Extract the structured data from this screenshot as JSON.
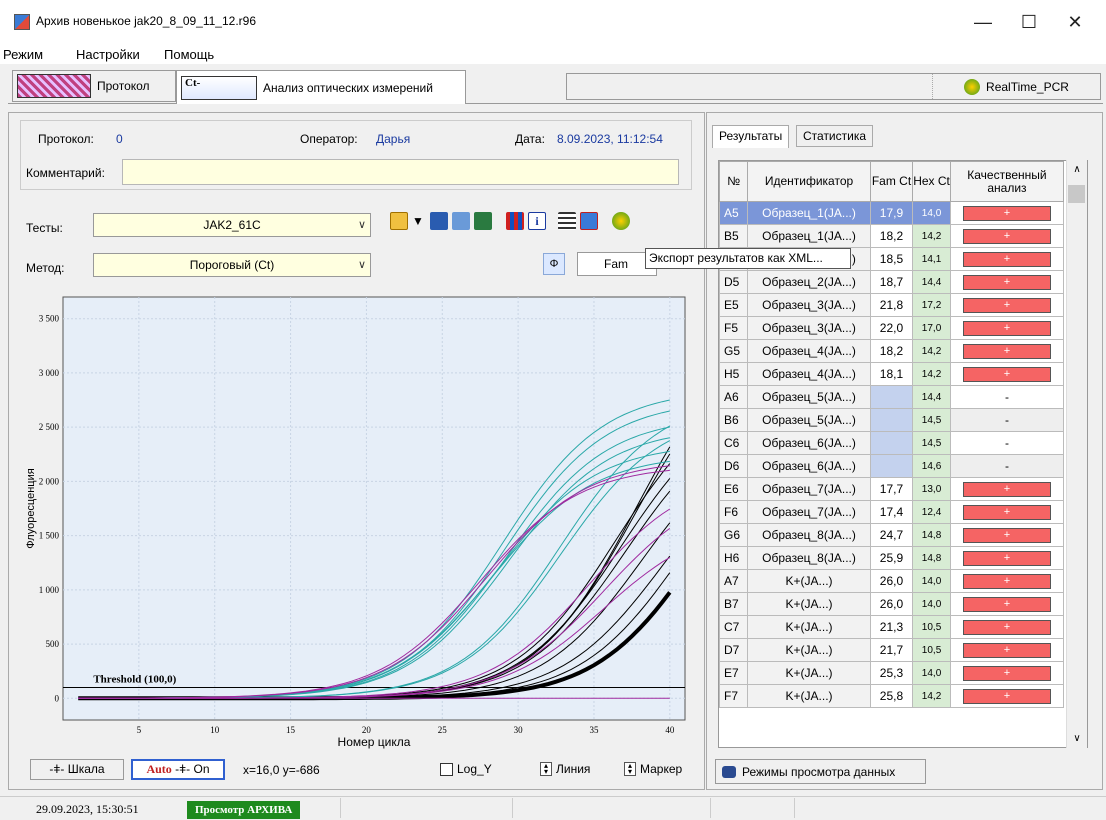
{
  "window": {
    "title": "Архив новенькое jak20_8_09_11_12.r96",
    "minimize": "—",
    "maximize": "☐",
    "close": "✕"
  },
  "menu": [
    "Режим",
    "Настройки",
    "Помощь"
  ],
  "tabs": [
    {
      "label": "Протокол"
    },
    {
      "label": "Анализ оптических измерений",
      "img_text": "Ct-"
    }
  ],
  "realtime_label": "RealTime_PCR",
  "info": {
    "protocol_label": "Протокол:",
    "protocol_value": "0",
    "operator_label": "Оператор:",
    "operator_value": "Дарья",
    "date_label": "Дата:",
    "date_value": "8.09.2023, 11:12:54",
    "comment_label": "Комментарий:",
    "comment_value": ""
  },
  "tests": {
    "label": "Тесты:",
    "value": "JAK2_61C"
  },
  "method": {
    "label": "Метод:",
    "value": "Пороговый (Ct)"
  },
  "tooltip": "Экспорт результатов как XML...",
  "channel": "Fam",
  "phi": "Φ",
  "chart_data": {
    "type": "line",
    "xlabel": "Номер цикла",
    "ylabel": "Флуоресценция",
    "xlim": [
      0,
      41
    ],
    "ylim": [
      -200,
      3700
    ],
    "xticks": [
      5,
      10,
      15,
      20,
      25,
      30,
      35,
      40
    ],
    "yticks": [
      0,
      500,
      1000,
      1500,
      2000,
      2500,
      3000,
      3500
    ],
    "ytick_labels": [
      "0",
      "500",
      "1 000",
      "1 500",
      "2 000",
      "2 500",
      "3 000",
      "3 500"
    ],
    "threshold": {
      "value": 100,
      "label": "Threshold (100,0)"
    },
    "series": [
      {
        "color": "#000000",
        "width": 4,
        "ct": 31.0,
        "max": 2650
      },
      {
        "color": "#000000",
        "width": 1,
        "ct": 26.0,
        "max": 3500
      },
      {
        "color": "#000000",
        "width": 1,
        "ct": 26.0,
        "max": 3350
      },
      {
        "color": "#000000",
        "width": 1,
        "ct": 25.3,
        "max": 2900
      },
      {
        "color": "#000000",
        "width": 1,
        "ct": 25.8,
        "max": 2800
      },
      {
        "color": "#000000",
        "width": 1,
        "ct": 26.2,
        "max": 2700
      },
      {
        "color": "#000000",
        "width": 1,
        "ct": 27.5,
        "max": 2550
      },
      {
        "color": "#000000",
        "width": 1,
        "ct": 29.0,
        "max": 2450
      },
      {
        "color": "#000000",
        "width": 1,
        "ct": 30.0,
        "max": 2600
      },
      {
        "color": "#2aa8a8",
        "width": 1,
        "ct": 17.9,
        "max": 2850
      },
      {
        "color": "#2aa8a8",
        "width": 1,
        "ct": 18.2,
        "max": 2750
      },
      {
        "color": "#2aa8a8",
        "width": 1,
        "ct": 18.5,
        "max": 2600
      },
      {
        "color": "#2aa8a8",
        "width": 1,
        "ct": 18.7,
        "max": 2500
      },
      {
        "color": "#2aa8a8",
        "width": 1,
        "ct": 21.8,
        "max": 2800
      },
      {
        "color": "#2aa8a8",
        "width": 1,
        "ct": 22.0,
        "max": 2650
      },
      {
        "color": "#2aa8a8",
        "width": 1,
        "ct": 18.2,
        "max": 2350
      },
      {
        "color": "#2aa8a8",
        "width": 1,
        "ct": 18.1,
        "max": 2250
      },
      {
        "color": "#a02aa0",
        "width": 1,
        "ct": 17.7,
        "max": 2200
      },
      {
        "color": "#a02aa0",
        "width": 1,
        "ct": 17.4,
        "max": 2150
      },
      {
        "color": "#a02aa0",
        "width": 1,
        "ct": 24.7,
        "max": 2100
      },
      {
        "color": "#a02aa0",
        "width": 1,
        "ct": 25.9,
        "max": 2000
      },
      {
        "color": "#a02aa0",
        "width": 1,
        "ct": 26.5,
        "max": 1650
      },
      {
        "color": "#a02aa0",
        "width": 1,
        "ct": null,
        "max": 0
      }
    ]
  },
  "chart_buttons": {
    "scale": "Шкала",
    "auto": "Auto",
    "auto_on": "On",
    "coords": "x=16,0 y=-686",
    "logy": "Log_Y",
    "line": "Линия",
    "marker": "Маркер"
  },
  "right_tabs": [
    "Результаты",
    "Статистика"
  ],
  "table": {
    "headers": [
      "№",
      "Идентификатор",
      "Fam Ct",
      "Hex Ct",
      "Качественный анализ"
    ],
    "rows": [
      {
        "pos": "A5",
        "id": "Образец_1(JA...)",
        "fam": "17,9",
        "hex": "14,0",
        "q": "+"
      },
      {
        "pos": "B5",
        "id": "Образец_1(JA...)",
        "fam": "18,2",
        "hex": "14,2",
        "q": "+"
      },
      {
        "pos": "C5",
        "id": "Образец_2(JA...)",
        "fam": "18,5",
        "hex": "14,1",
        "q": "+"
      },
      {
        "pos": "D5",
        "id": "Образец_2(JA...)",
        "fam": "18,7",
        "hex": "14,4",
        "q": "+"
      },
      {
        "pos": "E5",
        "id": "Образец_3(JA...)",
        "fam": "21,8",
        "hex": "17,2",
        "q": "+"
      },
      {
        "pos": "F5",
        "id": "Образец_3(JA...)",
        "fam": "22,0",
        "hex": "17,0",
        "q": "+"
      },
      {
        "pos": "G5",
        "id": "Образец_4(JA...)",
        "fam": "18,2",
        "hex": "14,2",
        "q": "+"
      },
      {
        "pos": "H5",
        "id": "Образец_4(JA...)",
        "fam": "18,1",
        "hex": "14,2",
        "q": "+"
      },
      {
        "pos": "A6",
        "id": "Образец_5(JA...)",
        "fam": "",
        "hex": "14,4",
        "q": "-"
      },
      {
        "pos": "B6",
        "id": "Образец_5(JA...)",
        "fam": "",
        "hex": "14,5",
        "q": "-"
      },
      {
        "pos": "C6",
        "id": "Образец_6(JA...)",
        "fam": "",
        "hex": "14,5",
        "q": "-"
      },
      {
        "pos": "D6",
        "id": "Образец_6(JA...)",
        "fam": "",
        "hex": "14,6",
        "q": "-"
      },
      {
        "pos": "E6",
        "id": "Образец_7(JA...)",
        "fam": "17,7",
        "hex": "13,0",
        "q": "+"
      },
      {
        "pos": "F6",
        "id": "Образец_7(JA...)",
        "fam": "17,4",
        "hex": "12,4",
        "q": "+"
      },
      {
        "pos": "G6",
        "id": "Образец_8(JA...)",
        "fam": "24,7",
        "hex": "14,8",
        "q": "+"
      },
      {
        "pos": "H6",
        "id": "Образец_8(JA...)",
        "fam": "25,9",
        "hex": "14,8",
        "q": "+"
      },
      {
        "pos": "A7",
        "id": "K+(JA...)",
        "fam": "26,0",
        "hex": "14,0",
        "q": "+"
      },
      {
        "pos": "B7",
        "id": "K+(JA...)",
        "fam": "26,0",
        "hex": "14,0",
        "q": "+"
      },
      {
        "pos": "C7",
        "id": "K+(JA...)",
        "fam": "21,3",
        "hex": "10,5",
        "q": "+"
      },
      {
        "pos": "D7",
        "id": "K+(JA...)",
        "fam": "21,7",
        "hex": "10,5",
        "q": "+"
      },
      {
        "pos": "E7",
        "id": "K+(JA...)",
        "fam": "25,3",
        "hex": "14,0",
        "q": "+"
      },
      {
        "pos": "F7",
        "id": "K+(JA...)",
        "fam": "25,8",
        "hex": "14,2",
        "q": "+"
      }
    ]
  },
  "view_modes": "Режимы просмотра данных",
  "status": {
    "datetime": "29.09.2023, 15:30:51",
    "mode": "Просмотр АРХИВА"
  }
}
